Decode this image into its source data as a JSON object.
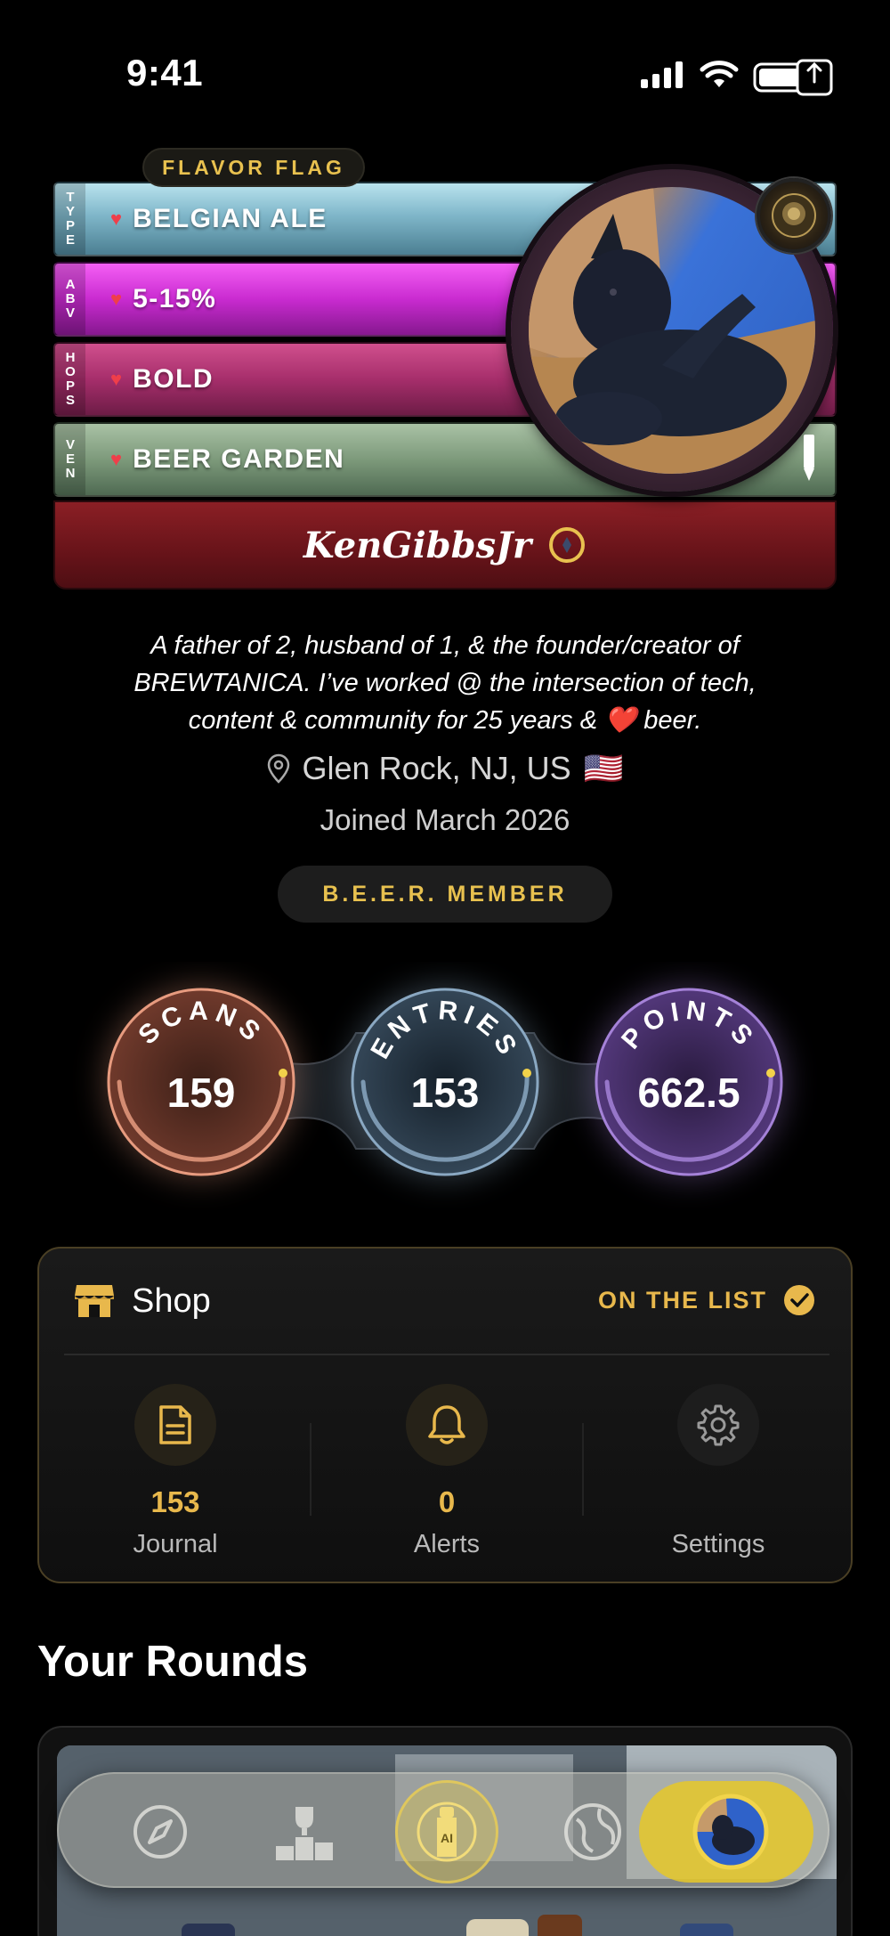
{
  "status_bar": {
    "time": "9:41"
  },
  "flavor_flag": {
    "title": "FLAVOR FLAG",
    "rows": [
      {
        "side": [
          "T",
          "Y",
          "P",
          "E"
        ],
        "value": "BELGIAN ALE"
      },
      {
        "side": [
          "A",
          "B",
          "V"
        ],
        "value": "5-15%"
      },
      {
        "side": [
          "H",
          "O",
          "P",
          "S"
        ],
        "value": "BOLD"
      },
      {
        "side": [
          "V",
          "E",
          "N"
        ],
        "value": "BEER GARDEN"
      }
    ]
  },
  "profile": {
    "username": "KenGibbsJr",
    "bio": "A father of 2, husband of 1, & the founder/creator of BREWTANICA. I’ve worked @ the intersection of tech, content & community for 25 years & ❤️ beer.",
    "location": "Glen Rock, NJ, US",
    "location_flag": "🇺🇸",
    "joined": "Joined March 2026",
    "member_badge": "B.E.E.R. MEMBER"
  },
  "stats": [
    {
      "label": "SCANS",
      "value": "159",
      "color": "#e79b7f"
    },
    {
      "label": "ENTRIES",
      "value": "153",
      "color": "#8aa8c2"
    },
    {
      "label": "POINTS",
      "value": "662.5",
      "color": "#a582d8"
    }
  ],
  "shop": {
    "title": "Shop",
    "status": "ON THE LIST",
    "items": [
      {
        "icon": "document-icon",
        "count": "153",
        "label": "Journal"
      },
      {
        "icon": "bell-icon",
        "count": "0",
        "label": "Alerts"
      },
      {
        "icon": "gear-icon",
        "count": "",
        "label": "Settings"
      }
    ]
  },
  "rounds": {
    "title": "Your Rounds"
  },
  "tab_bar": {
    "tabs": [
      "compass-icon",
      "trophy-podium-icon",
      "ai-bottle-icon",
      "globe-beer-icon",
      "profile-avatar-icon"
    ],
    "active": "profile-avatar-icon"
  },
  "colors": {
    "accent_gold": "#e8b84c",
    "name_bar_red": "#6a141a"
  }
}
